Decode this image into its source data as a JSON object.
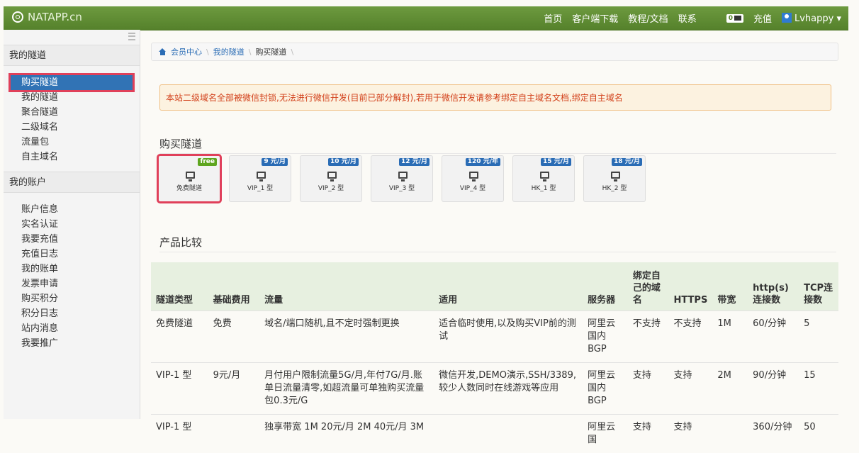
{
  "nav": {
    "brand": "NATAPP.cn",
    "links": [
      "首页",
      "客户端下载",
      "教程/文档",
      "联系"
    ],
    "balance": "0",
    "recharge": "充值",
    "user": "Lvhappy"
  },
  "sidebar": {
    "tunnels_head": "我的隧道",
    "tunnel_items": [
      "购买隧道",
      "我的隧道",
      "聚合隧道",
      "二级域名",
      "流量包",
      "自主域名"
    ],
    "account_head": "我的账户",
    "account_items": [
      "账户信息",
      "实名认证",
      "我要充值",
      "充值日志",
      "我的账单",
      "发票申请",
      "购买积分",
      "积分日志",
      "站内消息",
      "我要推广"
    ]
  },
  "breadcrumb": [
    "会员中心",
    "我的隧道",
    "购买隧道"
  ],
  "alert": "本站二级域名全部被微信封锁,无法进行微信开发(目前已部分解封),若用于微信开发请参考绑定自主域名文档,绑定自主域名",
  "buy_title": "购买隧道",
  "tiles": [
    {
      "price": "free",
      "label": "免费隧道"
    },
    {
      "price": "9 元/月",
      "label": "VIP_1 型"
    },
    {
      "price": "10 元/月",
      "label": "VIP_2 型"
    },
    {
      "price": "12 元/月",
      "label": "VIP_3 型"
    },
    {
      "price": "120 元/年",
      "label": "VIP_4 型"
    },
    {
      "price": "15 元/月",
      "label": "HK_1 型"
    },
    {
      "price": "18 元/月",
      "label": "HK_2 型"
    }
  ],
  "compare_title": "产品比较",
  "table": {
    "headers": [
      "隧道类型",
      "基础费用",
      "流量",
      "适用",
      "服务器",
      "绑定自己的域名",
      "HTTPS",
      "带宽",
      "http(s)连接数",
      "TCP连接数"
    ],
    "rows": [
      [
        "免费隧道",
        "免费",
        "域名/端口随机,且不定时强制更换",
        "适合临时使用,以及购买VIP前的测试",
        "阿里云国内BGP",
        "不支持",
        "不支持",
        "1M",
        "60/分钟",
        "5"
      ],
      [
        "VIP-1 型",
        "9元/月",
        "月付用户限制流量5G/月,年付7G/月.账单日流量清零,如超流量可单独购买流量包0.3元/G",
        "微信开发,DEMO演示,SSH/3389,较少人数同时在线游戏等应用",
        "阿里云国内BGP",
        "支持",
        "支持",
        "2M",
        "90/分钟",
        "15"
      ],
      [
        "VIP-1 型",
        "",
        "独享带宽 1M 20元/月 2M 40元/月 3M",
        "",
        "阿里云国",
        "支持",
        "支持",
        "",
        "360/分钟",
        "50"
      ]
    ]
  }
}
